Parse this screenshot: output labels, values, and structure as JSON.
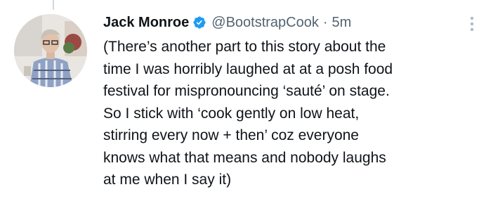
{
  "tweet": {
    "display_name": "Jack Monroe",
    "handle": "@BootstrapCook",
    "separator": "·",
    "time": "5m",
    "text": "(There’s another part to this story about the\ntime I was horribly laughed at at a posh food\nfestival for mispronouncing ‘sauté’ on stage.\nSo I stick with ‘cook gently on low heat,\nstirring every now + then’ coz everyone\nknows what that means and nobody laughs\nat me when I say it)"
  },
  "icons": {
    "verified": "verified-badge-icon",
    "more": "more-options-icon",
    "avatar": "profile-photo"
  },
  "colors": {
    "verified": "#1d9bf0",
    "secondary_text": "#536471",
    "primary_text": "#0f1419",
    "thread_line": "#cfd9de"
  }
}
